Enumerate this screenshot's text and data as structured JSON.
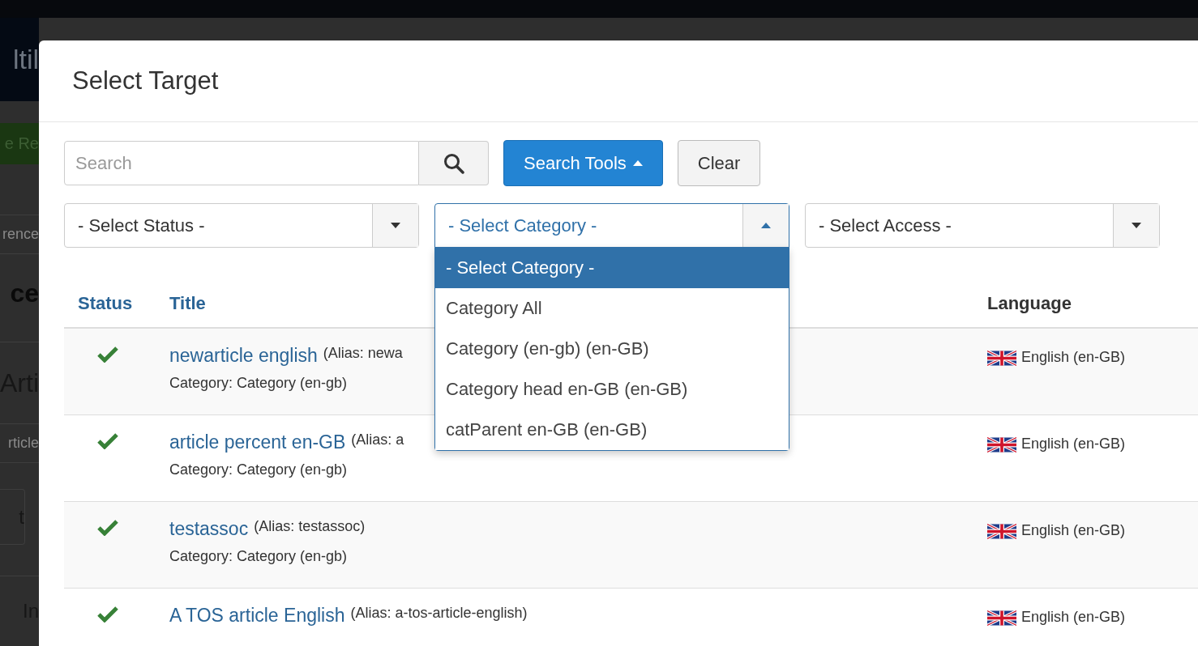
{
  "backdrop": [
    {
      "kind": "header",
      "text": "ltil"
    },
    {
      "kind": "button",
      "text": "e Re"
    },
    {
      "kind": "field",
      "text": "rence"
    },
    {
      "kind": "heading",
      "text": "ce"
    },
    {
      "kind": "big",
      "text": "Arti"
    },
    {
      "kind": "row",
      "text": "rticle"
    },
    {
      "kind": "tab",
      "text": "t"
    },
    {
      "kind": "item",
      "text": "In"
    }
  ],
  "modal": {
    "title": "Select Target"
  },
  "search": {
    "placeholder": "Search"
  },
  "search_tools": {
    "label": "Search Tools",
    "expanded": true
  },
  "clear": {
    "label": "Clear"
  },
  "filters": [
    {
      "label": "- Select Status -",
      "open": false
    },
    {
      "label": "- Select Category -",
      "open": true,
      "options": [
        {
          "label": "- Select Category -",
          "selected": true
        },
        {
          "label": "Category All",
          "selected": false
        },
        {
          "label": "Category (en-gb) (en-GB)",
          "selected": false
        },
        {
          "label": "Category head en-GB (en-GB)",
          "selected": false
        },
        {
          "label": "catParent en-GB (en-GB)",
          "selected": false
        }
      ]
    },
    {
      "label": "- Select Access -",
      "open": false
    }
  ],
  "table": {
    "columns": [
      {
        "label": "Status",
        "sortable": true
      },
      {
        "label": "Title",
        "sortable": true
      },
      {
        "label": "Language",
        "sortable": false
      }
    ],
    "rows": [
      {
        "published": true,
        "title": "newarticle english",
        "alias": "(Alias: newa",
        "category": "Category: Category (en-gb)",
        "language": "English (en-GB)"
      },
      {
        "published": true,
        "title": "article percent en-GB",
        "alias": "(Alias: a",
        "category": "Category: Category (en-gb)",
        "language": "English (en-GB)"
      },
      {
        "published": true,
        "title": "testassoc",
        "alias": "(Alias: testassoc)",
        "category": "Category: Category (en-gb)",
        "language": "English (en-GB)"
      },
      {
        "published": true,
        "title": "A TOS article English",
        "alias": "(Alias: a-tos-article-english)",
        "language": "English (en-GB)"
      }
    ]
  }
}
